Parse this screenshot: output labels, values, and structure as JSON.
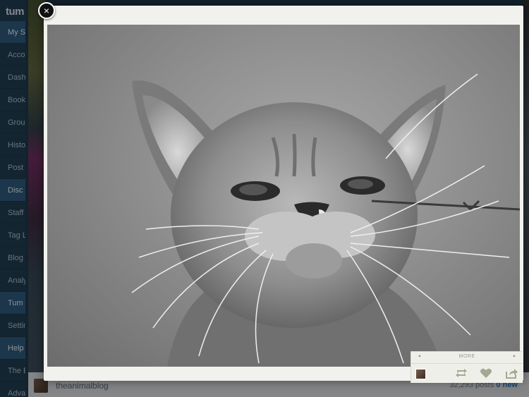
{
  "app": {
    "brand": "tum"
  },
  "sidebar": {
    "items": [
      {
        "label": "My S",
        "type": "header"
      },
      {
        "label": "Acco",
        "type": "item"
      },
      {
        "label": "Dash",
        "type": "item"
      },
      {
        "label": "Book",
        "type": "item"
      },
      {
        "label": "Grou",
        "type": "item"
      },
      {
        "label": "Histo",
        "type": "item"
      },
      {
        "label": "Post",
        "type": "item"
      },
      {
        "label": "Disc",
        "type": "header"
      },
      {
        "label": "Staff",
        "type": "item"
      },
      {
        "label": "Tag L",
        "type": "item"
      },
      {
        "label": "Blog",
        "type": "item"
      },
      {
        "label": "Analy",
        "type": "item"
      },
      {
        "label": "Tum",
        "type": "header"
      },
      {
        "label": "Settin",
        "type": "item"
      },
      {
        "label": "Help",
        "type": "header"
      },
      {
        "label": "The B",
        "type": "item"
      },
      {
        "label": "Adva",
        "type": "item"
      }
    ]
  },
  "post": {
    "blog_name": "theanimalblog",
    "posts_count": "32,293 posts",
    "new_count": "0 new"
  },
  "lightbox": {
    "close_glyph": "×",
    "more_label": "MORE",
    "caret_glyph": "▲"
  },
  "icons": {
    "close": "close-icon",
    "reblog": "reblog-icon",
    "like": "heart-icon",
    "share": "share-icon"
  },
  "colors": {
    "sidebar_bg": "#20394e",
    "sidebar_header": "#2c5473",
    "lightbox_bg": "#f1f1ed",
    "action_icon": "#a5a793",
    "new_count": "#2d6ea0"
  }
}
